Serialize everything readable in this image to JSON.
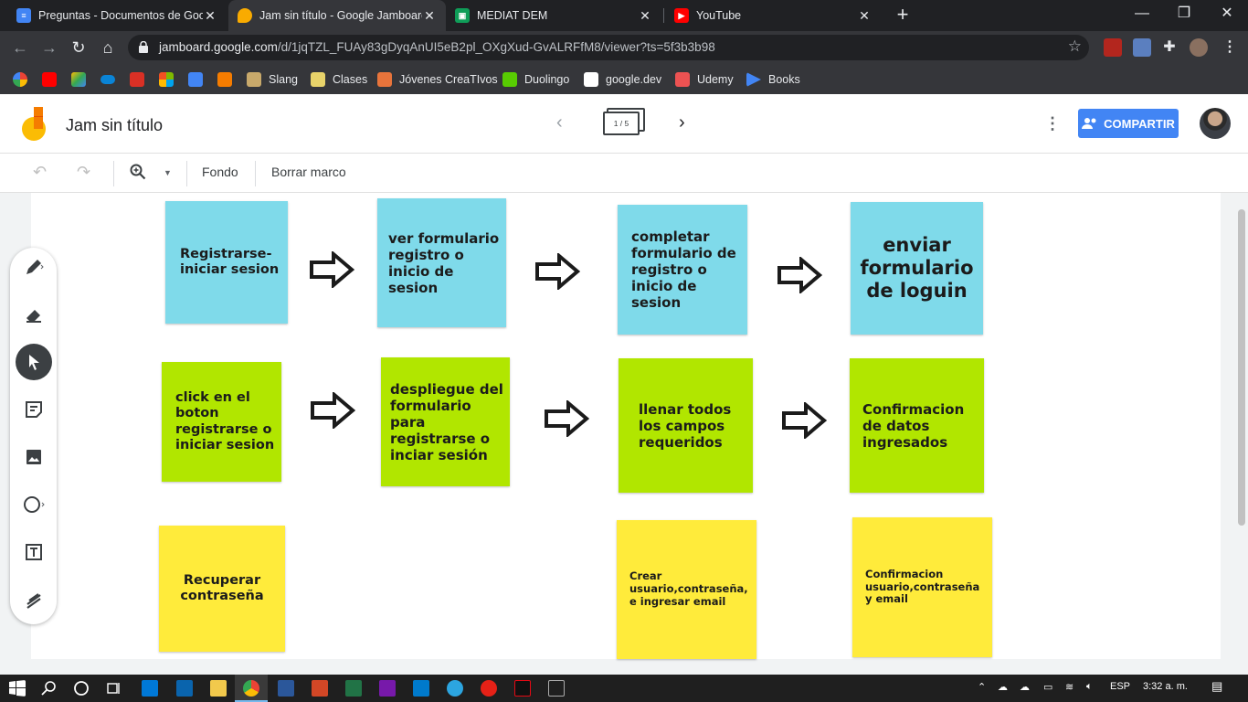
{
  "browser": {
    "tabs": [
      {
        "title": "Preguntas - Documentos de Goo",
        "favicon_color": "#4285f4",
        "favicon": "docs-icon",
        "active": false
      },
      {
        "title": "Jam sin título - Google Jamboard",
        "favicon_color": "#f9ab00",
        "favicon": "jamboard-icon",
        "active": true
      },
      {
        "title": "MEDIAT DEM",
        "favicon_color": "#0f9d58",
        "favicon": "classroom-icon",
        "active": false
      },
      {
        "title": "YouTube",
        "favicon_color": "#ff0000",
        "favicon": "youtube-icon",
        "active": false
      }
    ],
    "url_host": "jamboard.google.com",
    "url_path": "/d/1jqTZL_FUAy83gDyqAnUI5eB2pl_OXgXud-GvALRFfM8/viewer?ts=5f3b3b98",
    "bookmarks": [
      {
        "label": "Slang",
        "color": "#c8a96b"
      },
      {
        "label": "Clases",
        "color": "#e8d36a"
      },
      {
        "label": "Jóvenes CreaTIvos",
        "color": "#e8743b"
      },
      {
        "label": "Duolingo",
        "color": "#58cc02"
      },
      {
        "label": "google.dev",
        "color": "#ffffff"
      },
      {
        "label": "Udemy",
        "color": "#ec5252"
      },
      {
        "label": "Books",
        "color": "#4285f4"
      }
    ]
  },
  "jamboard": {
    "title": "Jam sin título",
    "frame_indicator": "1 / 5",
    "share_label": "COMPARTIR",
    "toolbar": {
      "fondo": "Fondo",
      "borrar_marco": "Borrar marco"
    },
    "notes": [
      {
        "text": "Registrarse- iniciar sesion",
        "color": "blue"
      },
      {
        "text": "ver formulario registro o inicio de sesion",
        "color": "blue"
      },
      {
        "text": "completar formulario de registro o inicio de sesion",
        "color": "blue"
      },
      {
        "text": "enviar formulario de loguin",
        "color": "blue"
      },
      {
        "text": "click en el boton registrarse o iniciar sesion",
        "color": "green"
      },
      {
        "text": "despliegue del formulario para registrarse o inciar sesión",
        "color": "green"
      },
      {
        "text": "llenar todos los campos requeridos",
        "color": "green"
      },
      {
        "text": "Confirmacion de datos ingresados",
        "color": "green"
      },
      {
        "text": "Recuperar contraseña",
        "color": "yellow"
      },
      {
        "text": "Crear usuario,contraseña, e ingresar email",
        "color": "yellow"
      },
      {
        "text": "Confirmacion usuario,contraseña y email",
        "color": "yellow"
      }
    ]
  },
  "taskbar": {
    "language": "ESP",
    "time": "3:32 a. m."
  }
}
